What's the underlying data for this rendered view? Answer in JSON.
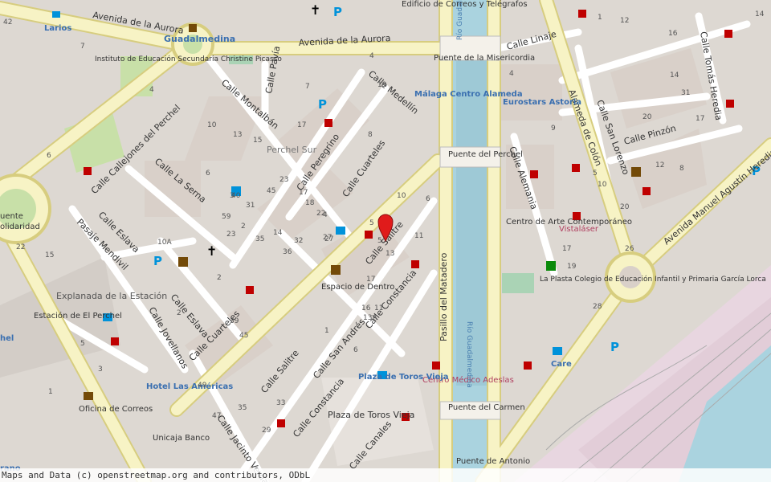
{
  "attribution": "Maps and Data (c) openstreetmap.org and contributors, ODbL",
  "marker": {
    "name": "Location marker",
    "color": "#e01b1b"
  },
  "colors": {
    "land": "#ddd8d2",
    "primary_road": "#f7f3c5",
    "primary_casing": "#d7cd7f",
    "water": "#aad3df",
    "green": "#c8e0a8",
    "rail": "#e8d6e0"
  },
  "streets": [
    "Avenida de la Aurora",
    "Avenida de la Aurora",
    "Calle Callejones del Perchel",
    "Calle La Serna",
    "Calle Montalbán",
    "Calle Pavía",
    "Calle Medellín",
    "Calle Peregrino",
    "Calle Cuarteles",
    "Calle Cuarteles",
    "Calle Salitre",
    "Calle Salitre",
    "Calle Eslava",
    "Calle Eslava",
    "Pasaje Mendivil",
    "Calle Jovellanos",
    "Calle San Andrés",
    "Calle Constancia",
    "Calle Constancia",
    "Calle Jacinto Verdaguer",
    "Calle Canales",
    "Pasillo del Matadero",
    "Calle Alemania",
    "Calle Linaje",
    "Alameda de Colón",
    "Calle San Lorenzo",
    "Calle Pinzón",
    "Avenida Manuel Agustín Heredia",
    "Calle Tomás Heredia"
  ],
  "places": [
    "Larios",
    "Guadalmedina",
    "Instituto de Educación Secundaria Christine Picasso",
    "Edificio de Correos y Telégrafos",
    "Málaga Centro Alameda",
    "Puente de la Misericordia",
    "Puente del Perchel",
    "Perchel Sur",
    "Eurostars Astoria",
    "Centro de Arte Contemporáneo",
    "Vistaláser",
    "Espacio de Dentro",
    "La Plasta Colegio de Educación Infantil y Primaria García Lorca",
    "Care",
    "Centro Médico Adeslas",
    "Plaza de Toros Vieja",
    "Plaza de Toros Vieja",
    "Puente del Carmen",
    "Puente de Antonio",
    "Explanada de la Estación",
    "Estación de El Perchel",
    "Hotel Las Américas",
    "Oficina de Correos",
    "Unicaja Banco",
    "Río Guadalmedina",
    "Río Guadalmedina",
    "uente",
    "olidaridad",
    "hel",
    "rano"
  ],
  "house_numbers": [
    "42",
    "7",
    "4",
    "4",
    "7",
    "19",
    "17",
    "10",
    "13",
    "15",
    "8",
    "10",
    "6",
    "5",
    "4",
    "27",
    "45",
    "23",
    "31",
    "23",
    "3",
    "40",
    "59",
    "35",
    "2",
    "14",
    "17",
    "18",
    "22",
    "27",
    "36",
    "32",
    "5",
    "13",
    "17",
    "16",
    "11",
    "13A",
    "1",
    "6",
    "10A",
    "39",
    "45",
    "49",
    "47",
    "35",
    "33",
    "29",
    "2",
    "2",
    "6",
    "11",
    "4",
    "9",
    "5",
    "17",
    "19",
    "28",
    "10",
    "20",
    "26",
    "31",
    "12",
    "8",
    "20",
    "17",
    "14",
    "1",
    "12",
    "16",
    "14",
    "22",
    "15",
    "6",
    "5",
    "3",
    "1"
  ]
}
